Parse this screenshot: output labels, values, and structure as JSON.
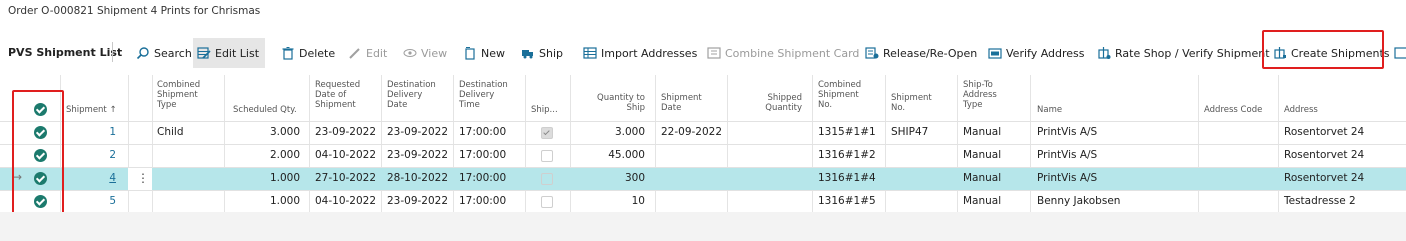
{
  "header": {
    "title": "Order O-000821 Shipment 4 Prints for Chrismas"
  },
  "toolbar": {
    "list_title": "PVS Shipment List",
    "search": "Search",
    "edit_list": "Edit List",
    "delete": "Delete",
    "edit": "Edit",
    "view": "View",
    "new": "New",
    "ship": "Ship",
    "import_addresses": "Import Addresses",
    "combine_shipment_card": "Combine Shipment Card",
    "release_reopen": "Release/Re-Open",
    "verify_address": "Verify Address",
    "rate_shop": "Rate Shop / Verify Shipment",
    "create_shipments": "Create Shipments"
  },
  "columns": {
    "shipment": "Shipment",
    "combined_type": [
      "Combined",
      "Shipment",
      "Type"
    ],
    "scheduled_qty": "Scheduled Qty.",
    "requested_date": [
      "Requested",
      "Date of",
      "Shipment"
    ],
    "dest_date": [
      "Destination",
      "Delivery",
      "Date"
    ],
    "dest_time": [
      "Destination",
      "Delivery",
      "Time"
    ],
    "ship": "Ship...",
    "qty_to_ship": [
      "Quantity to",
      "Ship"
    ],
    "shipment_date": [
      "Shipment",
      "Date"
    ],
    "shipped_qty": [
      "Shipped",
      "Quantity"
    ],
    "combined_no": [
      "Combined",
      "Shipment",
      "No."
    ],
    "shipment_no": [
      "Shipment",
      "No."
    ],
    "shipto_type": [
      "Ship-To",
      "Address",
      "Type"
    ],
    "name": "Name",
    "address_code": "Address Code",
    "address": "Address"
  },
  "rows": [
    {
      "shipment": "1",
      "combined_type": "Child",
      "scheduled_qty": "3.000",
      "requested_date": "23-09-2022",
      "dest_date": "23-09-2022",
      "dest_time": "17:00:00",
      "ship": true,
      "qty_to_ship": "3.000",
      "shipment_date": "22-09-2022",
      "shipped_qty": "",
      "combined_no": "1315#1#1",
      "shipment_no": "SHIP47",
      "shipto_type": "Manual",
      "name": "PrintVis A/S",
      "address_code": "",
      "address": "Rosentorvet 24"
    },
    {
      "shipment": "2",
      "combined_type": "",
      "scheduled_qty": "2.000",
      "requested_date": "04-10-2022",
      "dest_date": "23-09-2022",
      "dest_time": "17:00:00",
      "ship": false,
      "qty_to_ship": "45.000",
      "shipment_date": "",
      "shipped_qty": "",
      "combined_no": "1316#1#2",
      "shipment_no": "",
      "shipto_type": "Manual",
      "name": "PrintVis A/S",
      "address_code": "",
      "address": "Rosentorvet 24"
    },
    {
      "shipment": "4",
      "combined_type": "",
      "scheduled_qty": "1.000",
      "requested_date": "27-10-2022",
      "dest_date": "28-10-2022",
      "dest_time": "17:00:00",
      "ship": false,
      "qty_to_ship": "300",
      "shipment_date": "",
      "shipped_qty": "",
      "combined_no": "1316#1#4",
      "shipment_no": "",
      "shipto_type": "Manual",
      "name": "PrintVis A/S",
      "address_code": "",
      "address": "Rosentorvet 24"
    },
    {
      "shipment": "5",
      "combined_type": "",
      "scheduled_qty": "1.000",
      "requested_date": "04-10-2022",
      "dest_date": "23-09-2022",
      "dest_time": "17:00:00",
      "ship": false,
      "qty_to_ship": "10",
      "shipment_date": "",
      "shipped_qty": "",
      "combined_no": "1316#1#5",
      "shipment_no": "",
      "shipto_type": "Manual",
      "name": "Benny Jakobsen",
      "address_code": "",
      "address": "Testadresse 2"
    }
  ],
  "colors": {
    "selected_row": "#b6e6ea",
    "check_green": "#1c7a6d",
    "highlight_red": "#e01e1e",
    "link": "#1a6f99"
  }
}
